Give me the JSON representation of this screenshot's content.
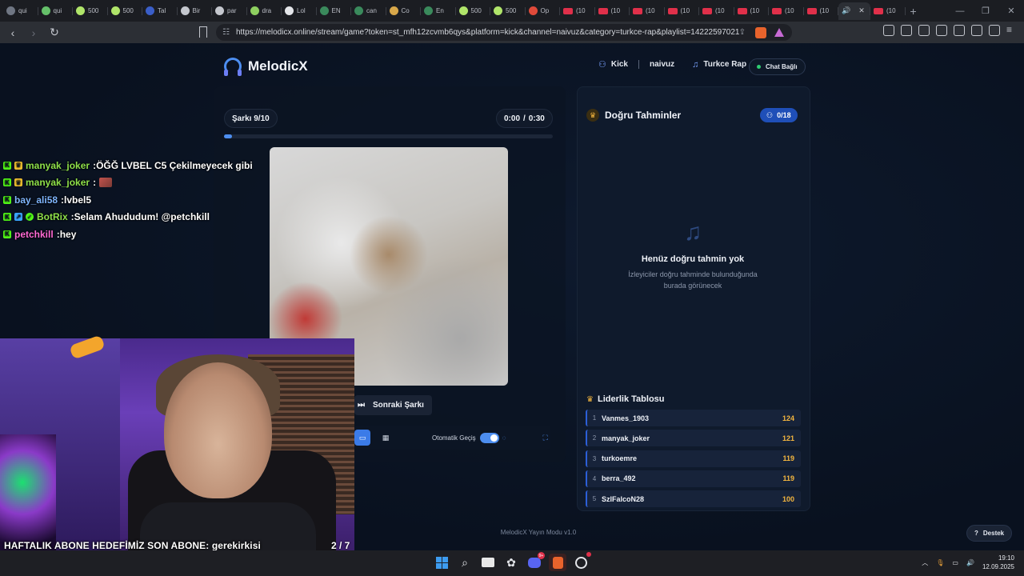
{
  "browser": {
    "tabs": [
      {
        "label": "qui",
        "color": "#6f7683"
      },
      {
        "label": "qui",
        "color": "#65c06a"
      },
      {
        "label": "500",
        "color": "#b0e56a"
      },
      {
        "label": "500",
        "color": "#b0e56a"
      },
      {
        "label": "Tal",
        "color": "#3a5ec8"
      },
      {
        "label": "Bir",
        "color": "#c4c7ce"
      },
      {
        "label": "par",
        "color": "#c4c7ce"
      },
      {
        "label": "dra",
        "color": "#8ed060"
      },
      {
        "label": "Lol",
        "color": "#e4e6ea"
      },
      {
        "label": "EN",
        "color": "#3a8a5c"
      },
      {
        "label": "can",
        "color": "#3a8a5c"
      },
      {
        "label": "Co",
        "color": "#d8a84a"
      },
      {
        "label": "En",
        "color": "#3a8a5c"
      },
      {
        "label": "500",
        "color": "#b0e56a"
      },
      {
        "label": "500",
        "color": "#b0e56a"
      },
      {
        "label": "Op",
        "color": "#e04a3a"
      }
    ],
    "youtube_tabs": [
      "(10",
      "(10",
      "(10",
      "(10",
      "(10",
      "(10",
      "(10",
      "(10"
    ],
    "last_tab": "(10",
    "url": "https://melodicx.online/stream/game?token=st_mfh12zcvmb6qys&platform=kick&channel=naivuz&category=turkce-rap&playlist=14222597021"
  },
  "app": {
    "name": "MelodicX",
    "platform": "Kick",
    "channel": "naivuz",
    "category": "Turkce Rap",
    "chat_status": "Chat Bağlı",
    "song_counter": "Şarkı 9/10",
    "time_current": "0:00",
    "time_sep": "/",
    "time_total": "0:30",
    "progress_fraction": 0.025,
    "next_button": "Sonraki Şarkı",
    "auto_advance_label": "Otomatik Geçiş",
    "auto_advance_on": true,
    "footer": "MelodicX Yayın Modu v1.0",
    "support_button": "Destek"
  },
  "guesses": {
    "title": "Doğru Tahminler",
    "count": "0/18",
    "empty_title": "Henüz doğru tahmin yok",
    "empty_line1": "İzleyiciler doğru tahminde bulunduğunda",
    "empty_line2": "burada görünecek"
  },
  "leaderboard": {
    "title": "Liderlik Tablosu",
    "rows": [
      {
        "rank": "1",
        "name": "Vanmes_1903",
        "score": "124"
      },
      {
        "rank": "2",
        "name": "manyak_joker",
        "score": "121"
      },
      {
        "rank": "3",
        "name": "turkoemre",
        "score": "119"
      },
      {
        "rank": "4",
        "name": "berra_492",
        "score": "119"
      },
      {
        "rank": "5",
        "name": "SzlFalcoN28",
        "score": "100"
      }
    ]
  },
  "chat": [
    {
      "user": "manyak_joker",
      "user_color": "#8ee04a",
      "text": "ÖĞĞ LVBEL C5 Çekilmeyecek gibi"
    },
    {
      "user": "manyak_joker",
      "user_color": "#8ee04a",
      "text": ""
    },
    {
      "user": "bay_ali58",
      "user_color": "#7fb6ff",
      "text": "lvbel5"
    },
    {
      "user": "BotRix",
      "user_color": "#8ee04a",
      "text": "Selam Ahududum! @petchkill"
    },
    {
      "user": "petchkill",
      "user_color": "#ff6ad5",
      "text": "hey"
    }
  ],
  "overlay": {
    "goal_text": "HAFTALIK ABONE HEDEFİMİZ SON ABONE: gerekirkisi",
    "goal_count": "2  / 7",
    "goal_fraction": 0.2857
  },
  "taskbar": {
    "time": "19:10",
    "date": "12.09.2025",
    "badge": "9+"
  }
}
